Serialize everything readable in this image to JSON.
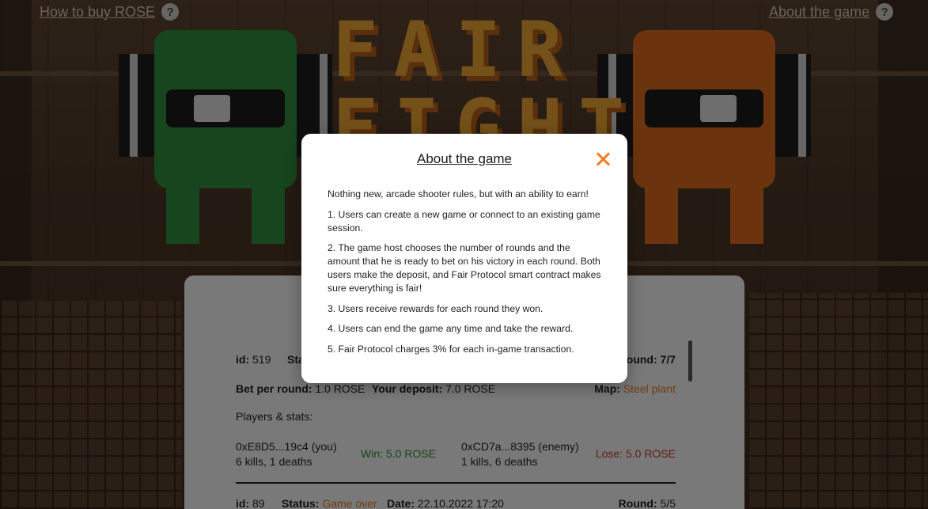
{
  "nav": {
    "how_to_buy": "How to buy ROSE",
    "about_game": "About the game",
    "help_glyph": "?"
  },
  "logo_text": "FAIR FIGHT",
  "games": [
    {
      "id_label": "id:",
      "id": "519",
      "status_label": "Status:",
      "round_label": "Round:",
      "round": "7/7",
      "bet_label": "Bet per round:",
      "bet": "1.0 ROSE",
      "deposit_label": "Your deposit:",
      "deposit": "7.0 ROSE",
      "map_label": "Map:",
      "map": "Steel plant",
      "players_label": "Players & stats:",
      "player1": {
        "address": "0xE8D5...19c4 (you)",
        "stats": "6 kills, 1 deaths",
        "result": "Win: 5.0 ROSE"
      },
      "player2": {
        "address": "0xCD7a...8395 (enemy)",
        "stats": "1 kills, 6 deaths",
        "result": "Lose: 5.0 ROSE"
      }
    },
    {
      "id_label": "id:",
      "id": "89",
      "status_label": "Status:",
      "status": "Game over",
      "date_label": "Date:",
      "date": "22.10.2022 17:20",
      "round_label": "Round:",
      "round": "5/5"
    }
  ],
  "modal": {
    "title": "About the game",
    "close_icon": "close-icon",
    "paragraphs": [
      "Nothing new, arcade shooter rules, but with an ability to earn!",
      "1. Users can create a new game or connect to an existing game session.",
      "2. The game host chooses the number of rounds and the amount that he is ready to bet on his victory in each round. Both users make the deposit, and Fair Protocol smart contract makes sure everything is fair!",
      "3. Users receive rewards for each round they won.",
      "4. Users can end the game any time and take the reward.",
      "5. Fair Protocol charges 3% for each in-game transaction."
    ]
  },
  "colors": {
    "accent": "#ef7d22",
    "win": "#2e8b2e",
    "lose": "#c0392b",
    "overlay": "rgba(0,0,0,0.5)"
  }
}
